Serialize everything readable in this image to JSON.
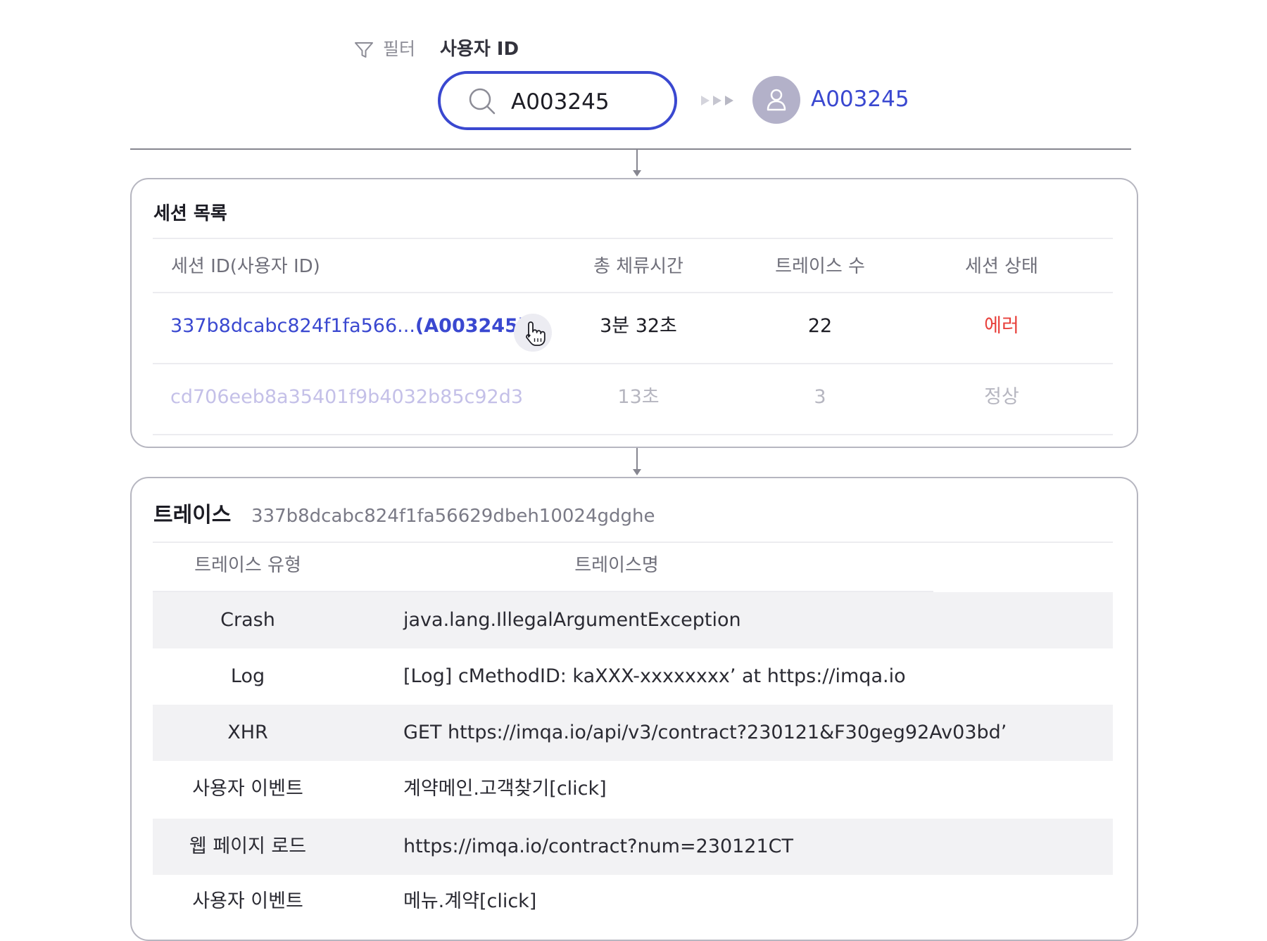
{
  "filter": {
    "icon": "funnel-icon",
    "label": "필터",
    "field_label": "사용자 ID"
  },
  "search": {
    "icon": "search-icon",
    "value": "A003245"
  },
  "result": {
    "icon": "user-icon",
    "user_id": "A003245"
  },
  "session_list": {
    "title": "세션 목록",
    "columns": [
      "세션 ID(사용자 ID)",
      "총 체류시간",
      "트레이스 수",
      "세션 상태"
    ],
    "rows": [
      {
        "id_prefix": "337b8dcabc824f1fa566...",
        "id_user": "(A003245)",
        "duration": "3분 32초",
        "trace_count": "22",
        "status": "에러",
        "status_color": "#e8413c"
      },
      {
        "id_prefix": "cd706eeb8a35401f9b4032b85c92d3",
        "id_user": "",
        "duration": "13초",
        "trace_count": "3",
        "status": "정상"
      }
    ]
  },
  "trace": {
    "title": "트레이스",
    "session_id": "337b8dcabc824f1fa56629dbeh10024gdghe",
    "columns": [
      "트레이스 유형",
      "트레이스명"
    ],
    "rows": [
      {
        "type": "Crash",
        "name": "java.lang.IllegalArgumentException"
      },
      {
        "type": "Log",
        "name": "[Log] cMethodID: kaXXX-xxxxxxxx’ at https://imqa.io"
      },
      {
        "type": "XHR",
        "name": "GET https://imqa.io/api/v3/contract?230121&F30geg92Av03bd’"
      },
      {
        "type": "사용자 이벤트",
        "name": "계약메인.고객찾기[click]"
      },
      {
        "type": "웹 페이지 로드",
        "name": "https://imqa.io/contract?num=230121CT"
      },
      {
        "type": "사용자 이벤트",
        "name": "메뉴.계약[click]"
      }
    ]
  },
  "colors": {
    "accent": "#3a48d0",
    "error": "#e8413c",
    "faded_link": "#c4c0e8",
    "row_shade": "#f2f2f4"
  }
}
